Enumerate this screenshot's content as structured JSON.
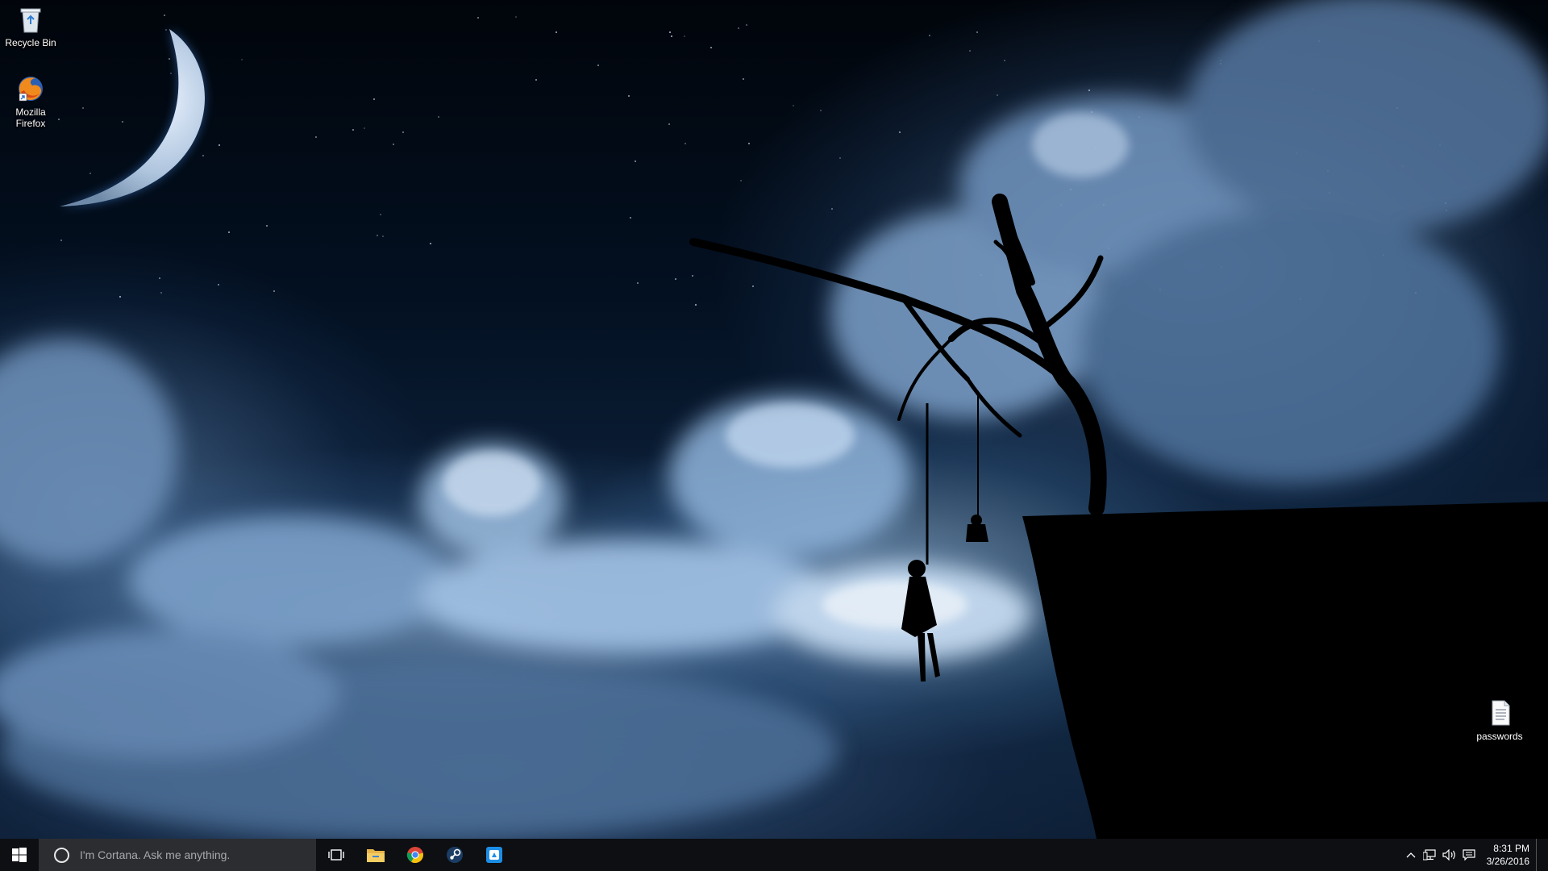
{
  "desktop": {
    "icons": [
      {
        "label": "Recycle Bin",
        "icon": "recycle-bin-icon"
      },
      {
        "label": "Mozilla Firefox",
        "icon": "firefox-icon"
      },
      {
        "label": "passwords",
        "icon": "text-file-icon"
      }
    ]
  },
  "taskbar": {
    "search_placeholder": "I'm Cortana. Ask me anything.",
    "pinned": [
      "task-view-icon",
      "file-explorer-icon",
      "chrome-icon",
      "steam-icon",
      "tile-app-icon"
    ],
    "clock": {
      "time": "8:31 PM",
      "date": "3/26/2016"
    },
    "tray": [
      "show-hidden-icons",
      "network-icon",
      "volume-icon",
      "action-center-icon"
    ]
  },
  "colors": {
    "taskbar": "#0e1014",
    "search": "#2b2d31",
    "accent_blue": "#1d8ee6"
  }
}
